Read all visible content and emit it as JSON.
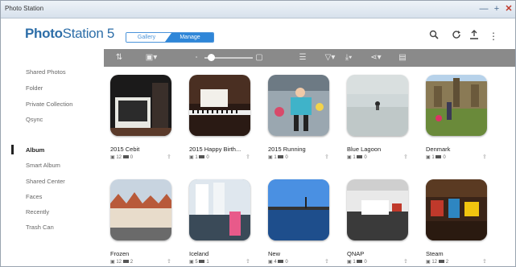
{
  "window": {
    "title": "Photo Station"
  },
  "header": {
    "brand_bold": "Photo",
    "brand_light": "Station 5",
    "toggle": [
      "Gallery",
      "Manage"
    ],
    "icons": [
      "search-icon",
      "refresh-icon",
      "upload-icon",
      "more-vertical-icon"
    ]
  },
  "sidebar": {
    "items": [
      {
        "label": "Shared Photos",
        "active": false
      },
      {
        "label": "Folder",
        "active": false
      },
      {
        "label": "Private Collection",
        "active": false
      },
      {
        "label": "Qsync",
        "active": false
      },
      {
        "label": "Album",
        "active": true
      },
      {
        "label": "Smart Album",
        "active": false
      },
      {
        "label": "Shared Center",
        "active": false
      },
      {
        "label": "Faces",
        "active": false
      },
      {
        "label": "Recently",
        "active": false
      },
      {
        "label": "Trash Can",
        "active": false
      }
    ]
  },
  "toolbar": {
    "icons": [
      "sort-icon",
      "display-mode-icon",
      "zoom-slider",
      "select-icon",
      "filter-icon",
      "download-icon",
      "share-icon",
      "info-icon"
    ]
  },
  "albums": [
    {
      "name": "2015 Cebit",
      "photos": "12",
      "videos": "0"
    },
    {
      "name": "2015 Happy Birth...",
      "photos": "1",
      "videos": "0"
    },
    {
      "name": "2015 Running",
      "photos": "1",
      "videos": "0"
    },
    {
      "name": "Blue Lagoon",
      "photos": "1",
      "videos": "0"
    },
    {
      "name": "Denmark",
      "photos": "1",
      "videos": "0"
    },
    {
      "name": "Frozen",
      "photos": "12",
      "videos": "2"
    },
    {
      "name": "Iceland",
      "photos": "5",
      "videos": "1"
    },
    {
      "name": "New",
      "photos": "4",
      "videos": "0"
    },
    {
      "name": "QNAP",
      "photos": "1",
      "videos": "0"
    },
    {
      "name": "Steam",
      "photos": "12",
      "videos": "2"
    }
  ]
}
